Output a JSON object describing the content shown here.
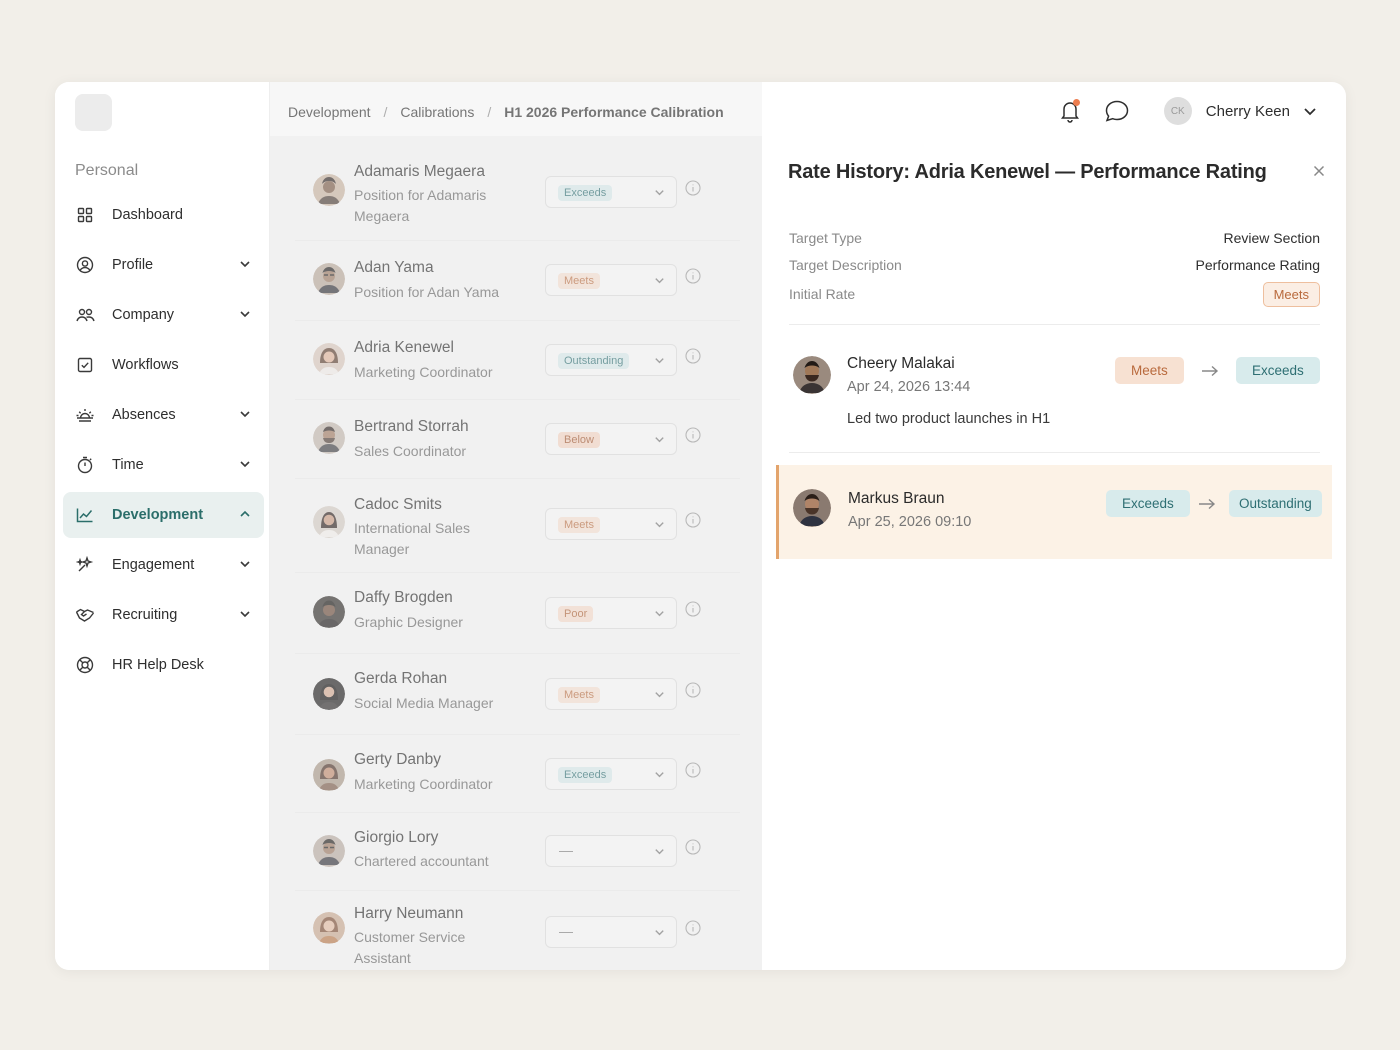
{
  "sidebar": {
    "section_title": "Personal",
    "items": [
      {
        "label": "Dashboard",
        "icon": "grid-icon"
      },
      {
        "label": "Profile",
        "icon": "user-circle-icon"
      },
      {
        "label": "Company",
        "icon": "people-icon"
      },
      {
        "label": "Workflows",
        "icon": "checkbox-icon"
      },
      {
        "label": "Absences",
        "icon": "sunrise-icon"
      },
      {
        "label": "Time",
        "icon": "stopwatch-icon"
      },
      {
        "label": "Development",
        "icon": "chart-line-icon"
      },
      {
        "label": "Engagement",
        "icon": "sparkle-icon"
      },
      {
        "label": "Recruiting",
        "icon": "handshake-icon"
      },
      {
        "label": "HR Help Desk",
        "icon": "lifebuoy-icon"
      }
    ]
  },
  "breadcrumb": {
    "items": [
      "Development",
      "Calibrations",
      "H1 2026 Performance Calibration"
    ],
    "separator": "/"
  },
  "user": {
    "initials": "CK",
    "name": "Cherry Keen"
  },
  "employees": [
    {
      "name": "Adamaris Megaera",
      "position": "Position for Adamaris Megaera",
      "rating": "Exceeds",
      "rating_style": "exceeds"
    },
    {
      "name": "Adan Yama",
      "position": "Position for Adan Yama",
      "rating": "Meets",
      "rating_style": "meets"
    },
    {
      "name": "Adria Kenewel",
      "position": "Marketing Coordinator",
      "rating": "Outstanding",
      "rating_style": "outstanding"
    },
    {
      "name": "Bertrand Storrah",
      "position": "Sales Coordinator",
      "rating": "Below",
      "rating_style": "below"
    },
    {
      "name": "Cadoc Smits",
      "position": "International Sales Manager",
      "rating": "Meets",
      "rating_style": "meets"
    },
    {
      "name": "Daffy Brogden",
      "position": "Graphic Designer",
      "rating": "Poor",
      "rating_style": "poor"
    },
    {
      "name": "Gerda Rohan",
      "position": "Social Media Manager",
      "rating": "Meets",
      "rating_style": "meets"
    },
    {
      "name": "Gerty Danby",
      "position": "Marketing Coordinator",
      "rating": "Exceeds",
      "rating_style": "exceeds"
    },
    {
      "name": "Giorgio Lory",
      "position": "Chartered accountant",
      "rating": "—",
      "rating_style": "empty"
    },
    {
      "name": "Harry Neumann",
      "position": "Customer Service Assistant",
      "rating": "—",
      "rating_style": "empty"
    }
  ],
  "drawer": {
    "title": "Rate History: Adria Kenewel — Performance Rating",
    "meta": {
      "target_type_label": "Target Type",
      "target_type_value": "Review Section",
      "target_desc_label": "Target Description",
      "target_desc_value": "Performance Rating",
      "initial_rate_label": "Initial Rate",
      "initial_rate_value": "Meets"
    },
    "history": [
      {
        "name": "Cheery Malakai",
        "date": "Apr 24, 2026 13:44",
        "from": "Meets",
        "to": "Exceeds",
        "comment": "Led two product launches in H1"
      },
      {
        "name": "Markus Braun",
        "date": "Apr 25, 2026 09:10",
        "from": "Exceeds",
        "to": "Outstanding",
        "comment": ""
      }
    ]
  },
  "colors": {
    "accent": "#2b6e6a",
    "active_bg": "#e9f0ef",
    "highlight_bg": "#fcf2e6",
    "highlight_border": "#e3a46c",
    "notification_dot": "#ec7d4f"
  }
}
